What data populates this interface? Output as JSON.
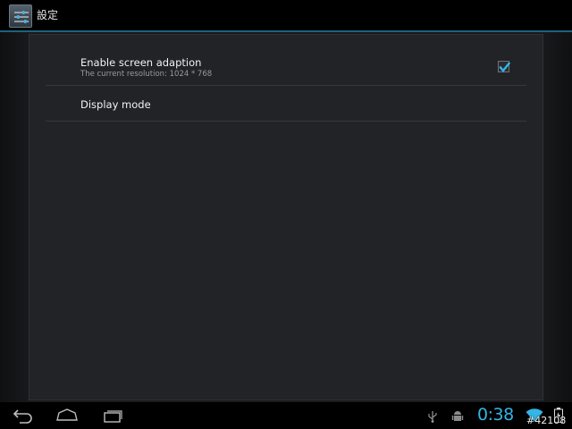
{
  "action_bar": {
    "title": "設定",
    "icon": "settings-sliders-icon"
  },
  "preferences": [
    {
      "title": "Enable screen adaption",
      "summary": "The current resolution: 1024 * 768",
      "checked": true
    },
    {
      "title": "Display mode"
    }
  ],
  "system_bar": {
    "nav": [
      "back-icon",
      "home-icon",
      "recent-apps-icon"
    ],
    "status_icons": [
      "usb-icon",
      "android-debug-icon",
      "wifi-icon",
      "battery-icon"
    ],
    "time": "0:38",
    "watermark": "#42108"
  },
  "colors": {
    "accent": "#33b5e5",
    "panel": "#222327",
    "background": "#000000"
  }
}
